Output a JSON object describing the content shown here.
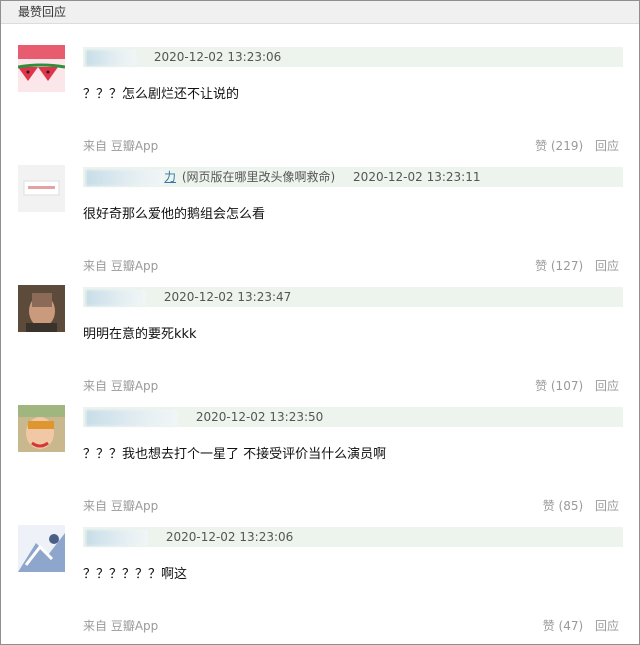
{
  "header": {
    "title": "最赞回应"
  },
  "comments": [
    {
      "time": "2020-12-02 13:23:06",
      "text": "？？？怎么剧烂还不让说的",
      "source": "来自  豆瓣App",
      "likes": "赞 (219)",
      "reply": "回应",
      "name_suffix": "",
      "ip_note": ""
    },
    {
      "time": "2020-12-02 13:23:11",
      "text": "很好奇那么爱他的鹅组会怎么看",
      "source": "来自  豆瓣App",
      "likes": "赞 (127)",
      "reply": "回应",
      "name_suffix": "力",
      "ip_note": "(网页版在哪里改头像啊救命)"
    },
    {
      "time": "2020-12-02 13:23:47",
      "text": "明明在意的要死kkk",
      "source": "来自  豆瓣App",
      "likes": "赞 (107)",
      "reply": "回应",
      "name_suffix": "",
      "ip_note": ""
    },
    {
      "time": "2020-12-02 13:23:50",
      "text": "？？？我也想去打个一星了 不接受评价当什么演员啊",
      "source": "来自  豆瓣App",
      "likes": "赞 (85)",
      "reply": "回应",
      "name_suffix": "",
      "ip_note": ""
    },
    {
      "time": "2020-12-02 13:23:06",
      "text": "？？？？？？啊这",
      "source": "来自  豆瓣App",
      "likes": "赞 (47)",
      "reply": "回应",
      "name_suffix": "",
      "ip_note": ""
    }
  ]
}
